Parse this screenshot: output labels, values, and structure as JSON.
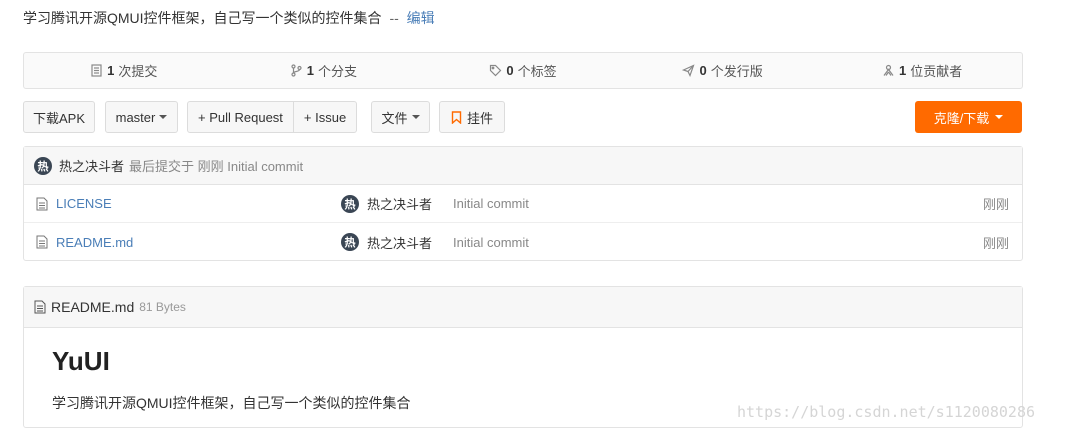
{
  "repo": {
    "description": "学习腾讯开源QMUI控件框架，自己写一个类似的控件集合",
    "separator": "--",
    "edit_label": "编辑"
  },
  "stats": [
    {
      "icon": "commit-icon",
      "count": "1",
      "label": "次提交"
    },
    {
      "icon": "branch-icon",
      "count": "1",
      "label": "个分支"
    },
    {
      "icon": "tag-icon",
      "count": "0",
      "label": "个标签"
    },
    {
      "icon": "release-icon",
      "count": "0",
      "label": "个发行版"
    },
    {
      "icon": "contributor-icon",
      "count": "1",
      "label": "位贡献者"
    }
  ],
  "toolbar": {
    "download_apk": "下载APK",
    "branch": "master",
    "pull_request": "+ Pull Request",
    "issue": "+ Issue",
    "files": "文件",
    "attach": "挂件",
    "clone": "克隆/下载"
  },
  "last_commit": {
    "avatar_char": "热",
    "author": "热之决斗者",
    "meta": "最后提交于 刚刚 Initial commit"
  },
  "files": [
    {
      "name": "LICENSE",
      "avatar_char": "热",
      "author": "热之决斗者",
      "message": "Initial commit",
      "time": "刚刚"
    },
    {
      "name": "README.md",
      "avatar_char": "热",
      "author": "热之决斗者",
      "message": "Initial commit",
      "time": "刚刚"
    }
  ],
  "readme": {
    "filename": "README.md",
    "size": "81 Bytes",
    "title": "YuUI",
    "body": "学习腾讯开源QMUI控件框架，自己写一个类似的控件集合"
  },
  "watermark": "https://blog.csdn.net/s1120080286",
  "colors": {
    "accent": "#ff6a00",
    "link": "#4a7eb7"
  }
}
